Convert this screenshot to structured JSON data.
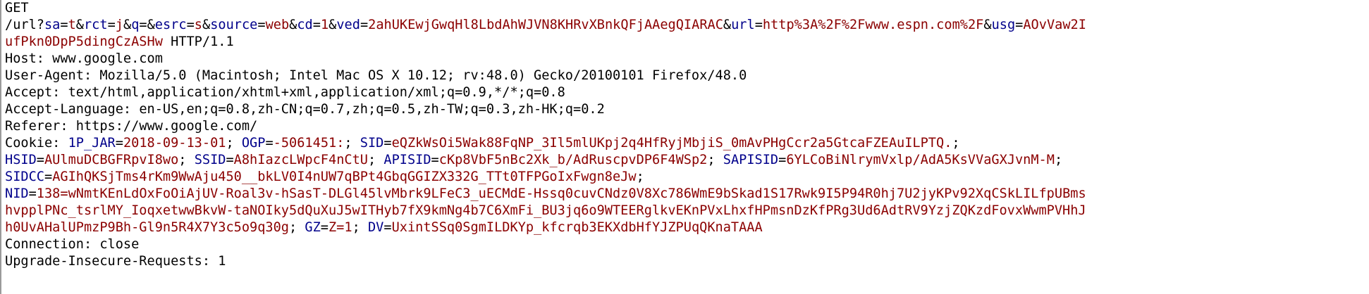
{
  "colors": {
    "key": "#00008b",
    "value": "#8b0000",
    "text": "#000000"
  },
  "request": {
    "method": "GET",
    "path": "/url?",
    "params": [
      {
        "key": "sa",
        "value": "t"
      },
      {
        "key": "rct",
        "value": "j"
      },
      {
        "key": "q",
        "value": ""
      },
      {
        "key": "esrc",
        "value": "s"
      },
      {
        "key": "source",
        "value": "web"
      },
      {
        "key": "cd",
        "value": "1"
      },
      {
        "key": "ved",
        "value": "2ahUKEwjGwqHl8LbdAhWJVN8KHRvXBnkQFjAAegQIARAC"
      },
      {
        "key": "url",
        "value": "http%3A%2F%2Fwww.espn.com%2F"
      },
      {
        "key": "usg",
        "value": "AOvVaw2IufPkn0DpP5dingCzASHw"
      }
    ],
    "protocol": "HTTP/1.1"
  },
  "headers": [
    {
      "name": "Host",
      "value": "www.google.com"
    },
    {
      "name": "User-Agent",
      "value": "Mozilla/5.0 (Macintosh; Intel Mac OS X 10.12; rv:48.0) Gecko/20100101 Firefox/48.0"
    },
    {
      "name": "Accept",
      "value": "text/html,application/xhtml+xml,application/xml;q=0.9,*/*;q=0.8"
    },
    {
      "name": "Accept-Language",
      "value": "en-US,en;q=0.8,zh-CN;q=0.7,zh;q=0.5,zh-TW;q=0.3,zh-HK;q=0.2"
    },
    {
      "name": "Referer",
      "value": "https://www.google.com/"
    }
  ],
  "cookie": {
    "name": "Cookie",
    "items": [
      {
        "key": "1P_JAR",
        "value": "2018-09-13-01"
      },
      {
        "key": "OGP",
        "value": "-5061451:"
      },
      {
        "key": "SID",
        "value": "eQZkWsOi5Wak88FqNP_3Il5mlUKpj2q4HfRyjMbjiS_0mAvPHgCcr2a5GtcaFZEAuILPTQ."
      },
      {
        "key": "HSID",
        "value": "AUlmuDCBGFRpvI8wo"
      },
      {
        "key": "SSID",
        "value": "A8hIazcLWpcF4nCtU"
      },
      {
        "key": "APISID",
        "value": "cKp8VbF5nBc2Xk_b/AdRuscpvDP6F4WSp2"
      },
      {
        "key": "SAPISID",
        "value": "6YLCoBiNlrymVxlp/AdA5KsVVaGXJvnM-M"
      },
      {
        "key": "SIDCC",
        "value": "AGIhQKSjTms4rKm9WwAju450__bkLV0I4nUW7qBPt4GbqGGIZX332G_TTt0TFPGoIxFwgn8eJw"
      },
      {
        "key": "NID",
        "value": "138=wNmtKEnLdOxFoOiAjUV-Roal3v-hSasT-DLGl45lvMbrk9LFeC3_uECMdE-Hssq0cuvCNdz0V8Xc786WmE9bSkad1S17Rwk9I5P94R0hj7U2jyKPv92XqCSkLILfpUBmshvpplPNc_tsrlMY_IoqxetwwBkvW-taNOIky5dQuXuJ5wITHyb7fX9kmNg4b7C6XmFi_BU3jq6o9WTEERglkvEKnPVxLhxfHPmsnDzKfPRg3Ud6AdtRV9YzjZQKzdFovxWwmPVHhJh0UvAHalUPmzP9Bh-Gl9n5R4X7Y3c5o9q30g"
      },
      {
        "key": "GZ",
        "value": "Z=1"
      },
      {
        "key": "DV",
        "value": "UxintSSq0SgmILDKYp_kfcrqb3EKXdbHfYJZPUqQKnaTAAA"
      }
    ]
  },
  "trailing_headers": [
    {
      "name": "Connection",
      "value": "close"
    },
    {
      "name": "Upgrade-Insecure-Requests",
      "value": "1"
    }
  ]
}
